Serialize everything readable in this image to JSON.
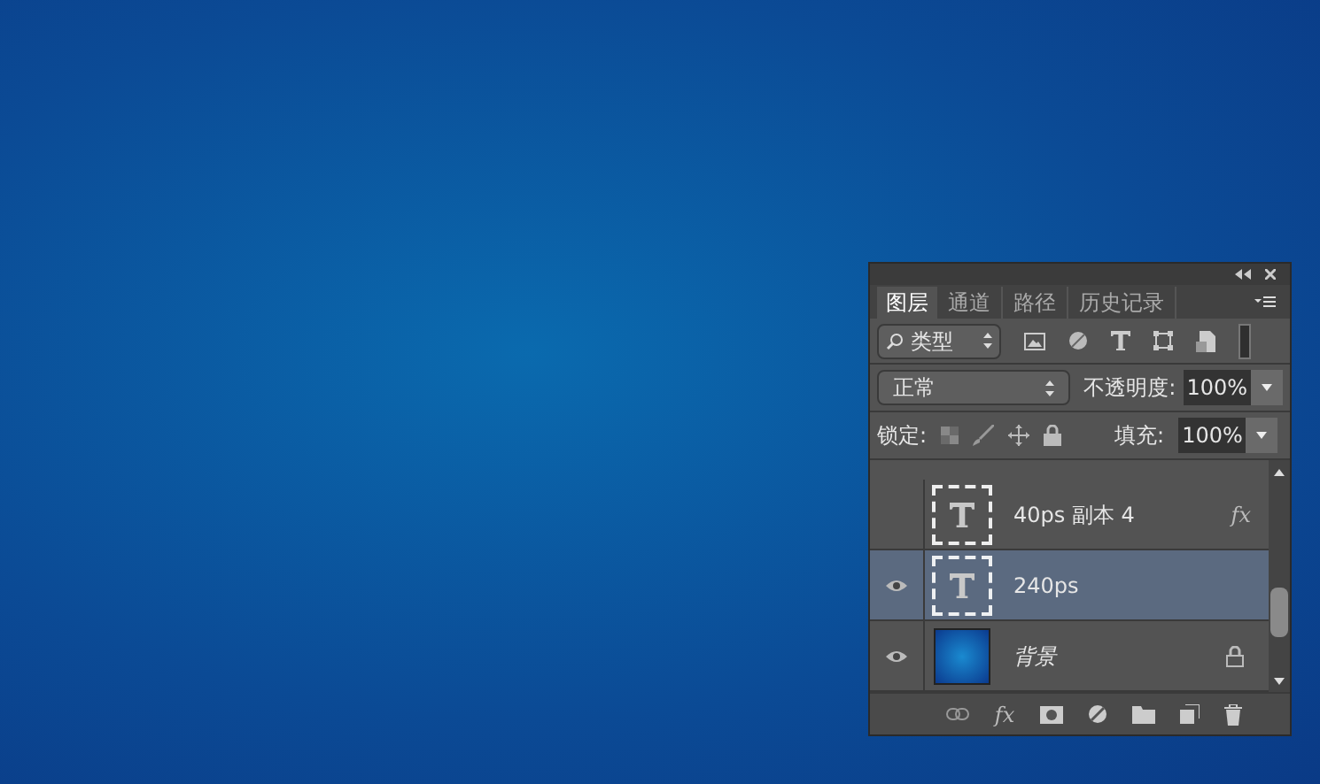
{
  "panel": {
    "tabs": [
      {
        "label": "图层",
        "selected": true
      },
      {
        "label": "通道",
        "selected": false
      },
      {
        "label": "路径",
        "selected": false
      },
      {
        "label": "历史记录",
        "selected": false
      }
    ],
    "filter": {
      "value": "类型"
    },
    "blend_mode": {
      "value": "正常"
    },
    "opacity": {
      "label": "不透明度:",
      "value": "100%"
    },
    "lock": {
      "label": "锁定:"
    },
    "effects_button": {
      "label": "fx"
    },
    "fill": {
      "label": "填充:",
      "value": "100%"
    },
    "layers": [
      {
        "name": "40ps 副本 4",
        "kind": "text",
        "visible": false,
        "selected": false,
        "locked": false,
        "effects": "fx"
      },
      {
        "name": "240ps",
        "kind": "text",
        "visible": true,
        "selected": true,
        "locked": false
      },
      {
        "name": "背景",
        "kind": "image",
        "visible": true,
        "selected": false,
        "locked": true
      }
    ]
  }
}
